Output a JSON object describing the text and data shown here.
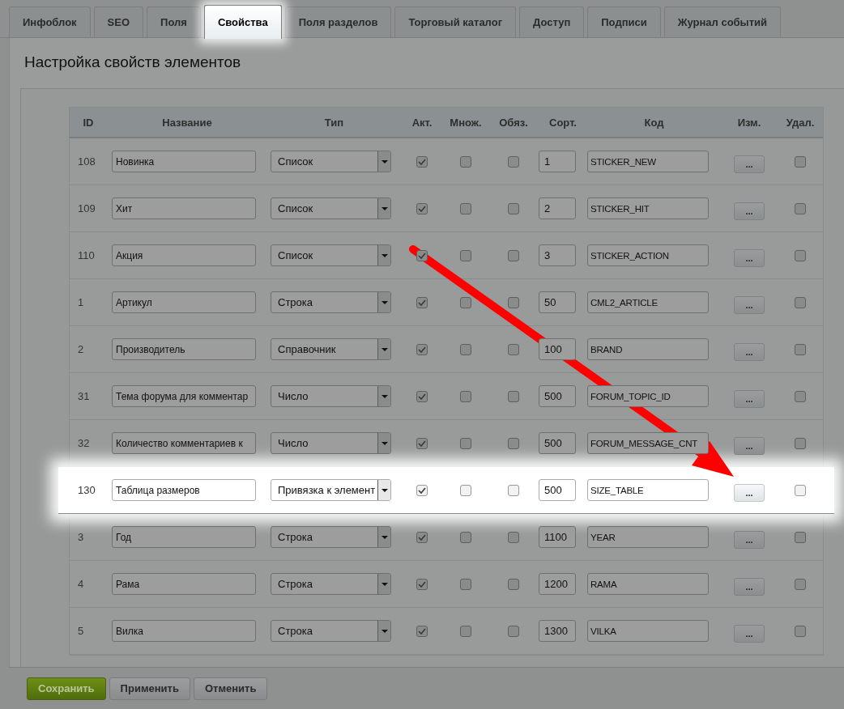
{
  "tabs": [
    {
      "label": "Инфоблок",
      "selected": false
    },
    {
      "label": "SEO",
      "selected": false
    },
    {
      "label": "Поля",
      "selected": false
    },
    {
      "label": "Свойства",
      "selected": true
    },
    {
      "label": "Поля разделов",
      "selected": false
    },
    {
      "label": "Торговый каталог",
      "selected": false
    },
    {
      "label": "Доступ",
      "selected": false
    },
    {
      "label": "Подписи",
      "selected": false
    },
    {
      "label": "Журнал событий",
      "selected": false
    }
  ],
  "title": "Настройка свойств элементов",
  "table": {
    "columns": [
      "ID",
      "Название",
      "Тип",
      "Акт.",
      "Множ.",
      "Обяз.",
      "Сорт.",
      "Код",
      "Изм.",
      "Удал."
    ],
    "rows": [
      {
        "id": "108",
        "name": "Новинка",
        "type": "Список",
        "active": true,
        "multiple": false,
        "required": false,
        "sort": "1",
        "code": "STICKER_NEW",
        "edit": "...",
        "delete": false,
        "highlighted": false
      },
      {
        "id": "109",
        "name": "Хит",
        "type": "Список",
        "active": true,
        "multiple": false,
        "required": false,
        "sort": "2",
        "code": "STICKER_HIT",
        "edit": "...",
        "delete": false,
        "highlighted": false
      },
      {
        "id": "110",
        "name": "Акция",
        "type": "Список",
        "active": true,
        "multiple": false,
        "required": false,
        "sort": "3",
        "code": "STICKER_ACTION",
        "edit": "...",
        "delete": false,
        "highlighted": false
      },
      {
        "id": "1",
        "name": "Артикул",
        "type": "Строка",
        "active": true,
        "multiple": false,
        "required": false,
        "sort": "50",
        "code": "CML2_ARTICLE",
        "edit": "...",
        "delete": false,
        "highlighted": false
      },
      {
        "id": "2",
        "name": "Производитель",
        "type": "Справочник",
        "active": true,
        "multiple": false,
        "required": false,
        "sort": "100",
        "code": "BRAND",
        "edit": "...",
        "delete": false,
        "highlighted": false
      },
      {
        "id": "31",
        "name": "Тема форума для комментар",
        "type": "Число",
        "active": true,
        "multiple": false,
        "required": false,
        "sort": "500",
        "code": "FORUM_TOPIC_ID",
        "edit": "...",
        "delete": false,
        "highlighted": false
      },
      {
        "id": "32",
        "name": "Количество комментариев к",
        "type": "Число",
        "active": true,
        "multiple": false,
        "required": false,
        "sort": "500",
        "code": "FORUM_MESSAGE_CNT",
        "edit": "...",
        "delete": false,
        "highlighted": false
      },
      {
        "id": "130",
        "name": "Таблица размеров",
        "type": "Привязка к элемент",
        "active": true,
        "multiple": false,
        "required": false,
        "sort": "500",
        "code": "SIZE_TABLE",
        "edit": "...",
        "delete": false,
        "highlighted": true
      },
      {
        "id": "3",
        "name": "Год",
        "type": "Строка",
        "active": true,
        "multiple": false,
        "required": false,
        "sort": "1100",
        "code": "YEAR",
        "edit": "...",
        "delete": false,
        "highlighted": false
      },
      {
        "id": "4",
        "name": "Рама",
        "type": "Строка",
        "active": true,
        "multiple": false,
        "required": false,
        "sort": "1200",
        "code": "RAMA",
        "edit": "...",
        "delete": false,
        "highlighted": false
      },
      {
        "id": "5",
        "name": "Вилка",
        "type": "Строка",
        "active": true,
        "multiple": false,
        "required": false,
        "sort": "1300",
        "code": "VILKA",
        "edit": "...",
        "delete": false,
        "highlighted": false
      }
    ]
  },
  "buttons": [
    {
      "label": "Сохранить",
      "kind": "primary"
    },
    {
      "label": "Применить",
      "kind": "normal"
    },
    {
      "label": "Отменить",
      "kind": "normal"
    }
  ]
}
